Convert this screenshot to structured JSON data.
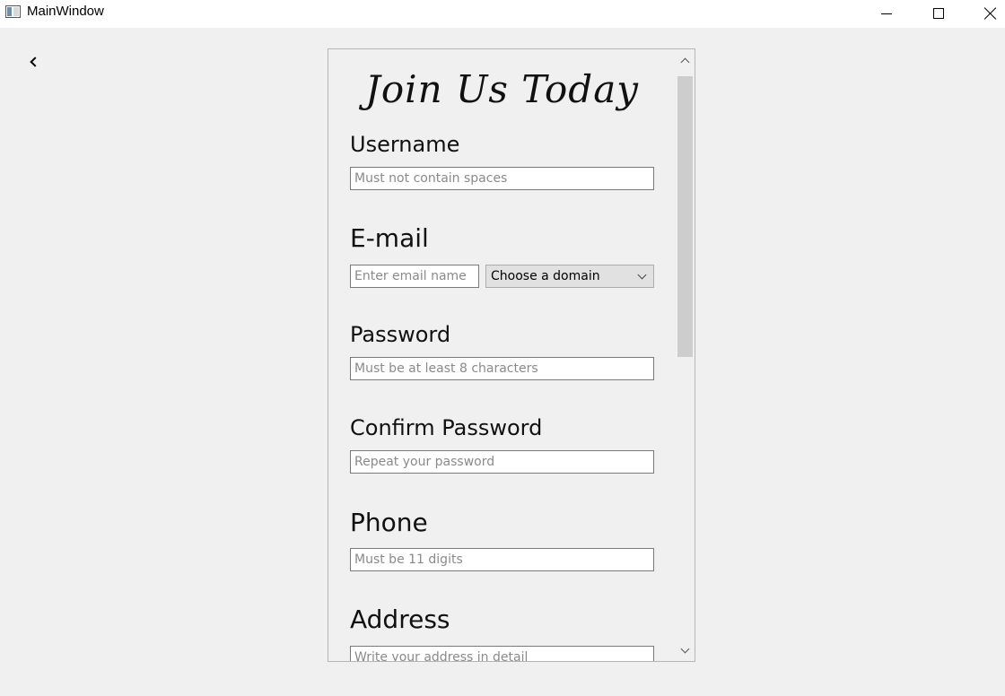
{
  "window": {
    "title": "MainWindow",
    "controls": {
      "minimize_icon": "minimize-icon",
      "maximize_icon": "maximize-icon",
      "close_icon": "close-icon"
    }
  },
  "nav": {
    "back_icon": "chevron-left-icon"
  },
  "form": {
    "title": "Join Us Today",
    "username": {
      "label": "Username",
      "placeholder": "Must not contain spaces"
    },
    "email": {
      "label": "E-mail",
      "name_placeholder": "Enter email name",
      "domain_selected": "Choose a domain"
    },
    "password": {
      "label": "Password",
      "placeholder": "Must be at least 8 characters"
    },
    "confirm_password": {
      "label": "Confirm Password",
      "placeholder": "Repeat your password"
    },
    "phone": {
      "label": "Phone",
      "placeholder": "Must be 11 digits"
    },
    "address": {
      "label": "Address",
      "placeholder": "Write your address in detail"
    }
  },
  "colors": {
    "window_background": "#f0f0f0",
    "titlebar": "#ffffff",
    "input_border": "#7a7a7a",
    "select_background": "#e1e1e1",
    "scroll_thumb": "#cdcdcd"
  }
}
